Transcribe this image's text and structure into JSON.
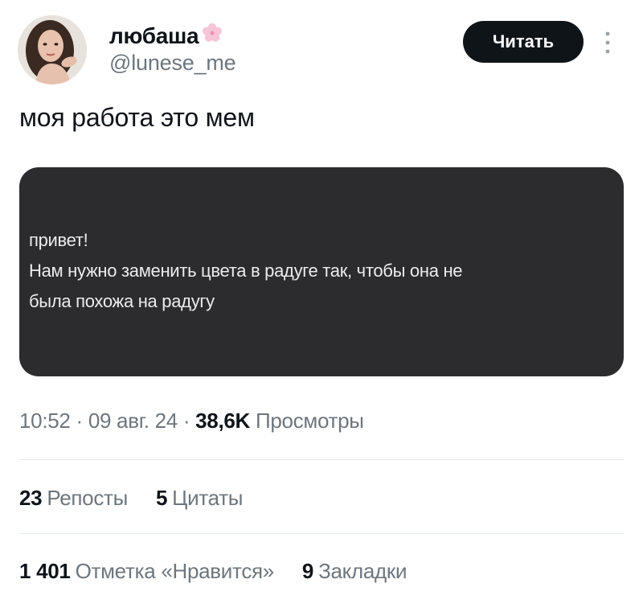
{
  "author": {
    "display_name": "любаша",
    "handle": "@lunese_me",
    "avatar_icon": "user-avatar",
    "name_emoji_icon": "cherry-blossom-icon"
  },
  "follow_button": {
    "label": "Читать"
  },
  "more_icon": "more-vertical-icon",
  "tweet": {
    "text": "моя работа это мем",
    "media": {
      "lines": [
        "привет!",
        "Нам нужно заменить цвета в радуге так, чтобы она не",
        "была похожа на радугу"
      ]
    }
  },
  "meta": {
    "time": "10:52",
    "separator": "·",
    "date": "09 авг. 24",
    "views_count": "38,6K",
    "views_label": "Просмотры"
  },
  "stats": {
    "reposts_count": "23",
    "reposts_label": "Репосты",
    "quotes_count": "5",
    "quotes_label": "Цитаты",
    "likes_count": "1 401",
    "likes_label": "Отметка «Нравится»",
    "bookmarks_count": "9",
    "bookmarks_label": "Закладки"
  },
  "colors": {
    "text_primary": "#0f1419",
    "text_secondary": "#6e767d",
    "follow_button_bg": "#0f1419",
    "media_bg": "#2c2c2e",
    "divider": "#e6e9eb"
  }
}
